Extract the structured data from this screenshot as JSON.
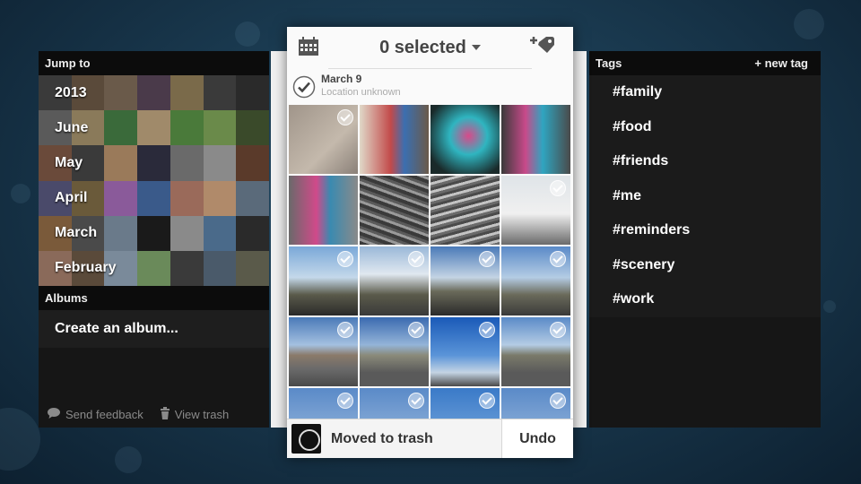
{
  "left_panel": {
    "jump_to_label": "Jump to",
    "months": [
      "2013",
      "June",
      "May",
      "April",
      "March",
      "February"
    ],
    "albums_label": "Albums",
    "create_album_label": "Create an album...",
    "send_feedback_label": "Send feedback",
    "view_trash_label": "View trash"
  },
  "right_panel": {
    "tags_label": "Tags",
    "new_tag_label": "+ new tag",
    "tags": [
      "#family",
      "#food",
      "#friends",
      "#me",
      "#reminders",
      "#scenery",
      "#work"
    ]
  },
  "main": {
    "selected_label": "0 selected",
    "date_title": "March 9",
    "location_label": "Location unknown",
    "toast_message": "Moved to trash",
    "undo_label": "Undo"
  },
  "icons": {
    "calendar": "calendar-icon",
    "add_tag": "add-tag-icon",
    "feedback": "speech-bubble-icon",
    "trash": "trash-icon",
    "check": "checkmark-icon"
  },
  "colors": {
    "background": "#1a3a50",
    "panel": "#161616",
    "card": "#fafafa",
    "text_dark": "#444444"
  }
}
